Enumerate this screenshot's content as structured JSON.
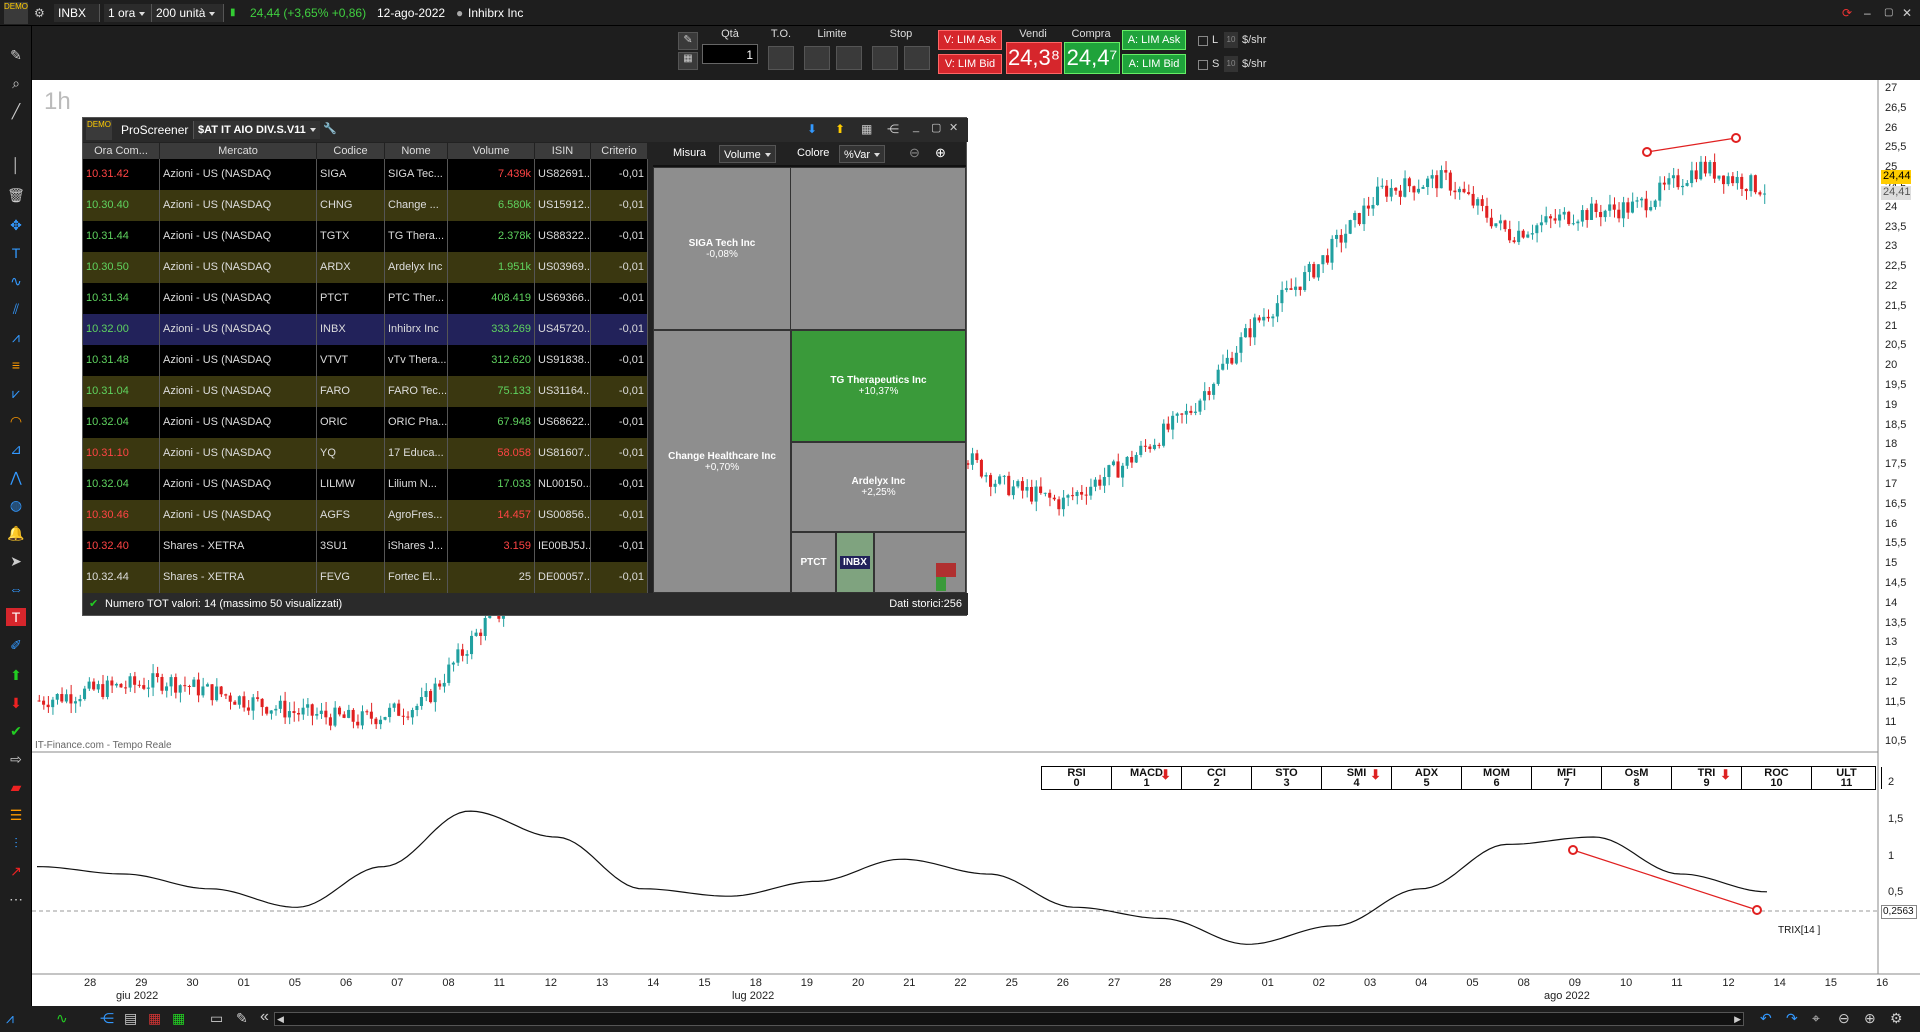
{
  "topbar": {
    "symbol": "INBX",
    "timeframe": "1 ora",
    "quantity": "200 unità",
    "last_price_change": "24,44 (+3,65% +0,86)",
    "date": "12-ago-2022",
    "company": "Inhibrx Inc"
  },
  "orderbar": {
    "qty_label": "Qtà",
    "qty_value": "1",
    "to_label": "T.O.",
    "limit_label": "Limite",
    "stop_label": "Stop",
    "sell_lim_ask": "V: LIM Ask",
    "sell_lim_bid": "V: LIM Bid",
    "sell_label": "Vendi",
    "sell_price": "24,3⁸",
    "buy_label": "Compra",
    "buy_price": "24,4⁷",
    "buy_lim_ask": "A: LIM Ask",
    "buy_lim_bid": "A: LIM Bid",
    "l_label": "L",
    "s_label": "S",
    "l_value": "10",
    "s_value": "10",
    "unit": "$/shr"
  },
  "chart": {
    "timeframe_label": "1h",
    "source": "IT-Finance.com - Tempo Reale",
    "price_last": "24,44",
    "price_prev": "24,41",
    "y_ticks": [
      "27",
      "26,5",
      "26",
      "25,5",
      "25",
      "24,5",
      "24",
      "23,5",
      "23",
      "22,5",
      "22",
      "21,5",
      "21",
      "20,5",
      "20",
      "19,5",
      "19",
      "18,5",
      "18",
      "17,5",
      "17",
      "16,5",
      "16",
      "15,5",
      "15",
      "14,5",
      "14",
      "13,5",
      "13",
      "12,5",
      "12",
      "11,5",
      "11",
      "10,5"
    ],
    "x_ticks": [
      "28",
      "29",
      "30",
      "01",
      "05",
      "06",
      "07",
      "08",
      "11",
      "12",
      "13",
      "14",
      "15",
      "18",
      "19",
      "20",
      "21",
      "22",
      "25",
      "26",
      "27",
      "28",
      "29",
      "01",
      "02",
      "03",
      "04",
      "05",
      "08",
      "09",
      "10",
      "11",
      "12",
      "14",
      "15",
      "16"
    ],
    "months": [
      "giu 2022",
      "lug 2022",
      "ago 2022"
    ],
    "trix_label": "TRIX[14 ]",
    "trix_value": "0,2563",
    "ind_y_ticks": [
      "2",
      "1,5",
      "1",
      "0,5"
    ]
  },
  "chart_data": {
    "type": "line",
    "title": "",
    "xlabel": "",
    "ylabel": "",
    "note_candles": "INBX hourly candles",
    "series": [
      {
        "name": "INBX",
        "values": [
          11.5,
          11.8,
          12.0,
          11.6,
          11.2,
          11.0,
          11.4,
          13.5,
          14.5,
          18.0,
          19.5,
          19.0,
          18.6,
          19.0,
          18.4,
          17.0,
          16.5,
          17.5,
          18.8,
          21.0,
          22.5,
          24.4,
          24.7,
          23.3,
          23.8,
          24.0,
          25.0,
          24.44
        ]
      },
      {
        "name": "TRIX[14 ]",
        "values": [
          0.6,
          0.5,
          0.3,
          0.05,
          0.6,
          1.35,
          1.0,
          0.3,
          0.2,
          0.4,
          0.7,
          0.5,
          0.05,
          -0.1,
          -0.45,
          -0.2,
          0.3,
          0.9,
          1.0,
          0.5,
          0.26
        ]
      }
    ],
    "ylim": [
      10.5,
      27
    ]
  },
  "indicator_tabs": [
    {
      "name": "RSI",
      "num": "0",
      "arrow": false
    },
    {
      "name": "MACD",
      "num": "1",
      "arrow": true
    },
    {
      "name": "CCI",
      "num": "2",
      "arrow": false
    },
    {
      "name": "STO",
      "num": "3",
      "arrow": false
    },
    {
      "name": "SMI",
      "num": "4",
      "arrow": true
    },
    {
      "name": "ADX",
      "num": "5",
      "arrow": false
    },
    {
      "name": "MOM",
      "num": "6",
      "arrow": false
    },
    {
      "name": "MFI",
      "num": "7",
      "arrow": false
    },
    {
      "name": "OsM",
      "num": "8",
      "arrow": false
    },
    {
      "name": "TRI",
      "num": "9",
      "arrow": true
    },
    {
      "name": "ROC",
      "num": "10",
      "arrow": false
    },
    {
      "name": "ULT",
      "num": "11",
      "arrow": false
    }
  ],
  "screener": {
    "title": "ProScreener",
    "preset": "$AT IT AIO DIV.S.V11",
    "columns": [
      "Ora Com...",
      "Mercato",
      "Codice",
      "Nome",
      "Volume",
      "ISIN",
      "Criterio"
    ],
    "rows": [
      {
        "time": "10.31.42",
        "market": "Azioni - US (NASDAQ",
        "code": "SIGA",
        "name": "SIGA Tec...",
        "volume": "7.439k",
        "isin": "US82691...",
        "crit": "-0,01",
        "tcolor": "#ff4444",
        "vcolor": "#ff4444",
        "bg": "#000000"
      },
      {
        "time": "10.30.40",
        "market": "Azioni - US (NASDAQ",
        "code": "CHNG",
        "name": "Change ...",
        "volume": "6.580k",
        "isin": "US15912...",
        "crit": "-0,01",
        "tcolor": "#5fd35f",
        "vcolor": "#5fd35f",
        "bg": "#3a3710"
      },
      {
        "time": "10.31.44",
        "market": "Azioni - US (NASDAQ",
        "code": "TGTX",
        "name": "TG Thera...",
        "volume": "2.378k",
        "isin": "US88322...",
        "crit": "-0,01",
        "tcolor": "#5fd35f",
        "vcolor": "#5fd35f",
        "bg": "#000000"
      },
      {
        "time": "10.30.50",
        "market": "Azioni - US (NASDAQ",
        "code": "ARDX",
        "name": "Ardelyx Inc",
        "volume": "1.951k",
        "isin": "US03969...",
        "crit": "-0,01",
        "tcolor": "#5fd35f",
        "vcolor": "#5fd35f",
        "bg": "#3a3710"
      },
      {
        "time": "10.31.34",
        "market": "Azioni - US (NASDAQ",
        "code": "PTCT",
        "name": "PTC Ther...",
        "volume": "408.419",
        "isin": "US69366...",
        "crit": "-0,01",
        "tcolor": "#5fd35f",
        "vcolor": "#5fd35f",
        "bg": "#000000"
      },
      {
        "time": "10.32.00",
        "market": "Azioni - US (NASDAQ",
        "code": "INBX",
        "name": "Inhibrx Inc",
        "volume": "333.269",
        "isin": "US45720...",
        "crit": "-0,01",
        "tcolor": "#5fd35f",
        "vcolor": "#5fd35f",
        "bg": "#22225a"
      },
      {
        "time": "10.31.48",
        "market": "Azioni - US (NASDAQ",
        "code": "VTVT",
        "name": "vTv Thera...",
        "volume": "312.620",
        "isin": "US91838...",
        "crit": "-0,01",
        "tcolor": "#5fd35f",
        "vcolor": "#5fd35f",
        "bg": "#000000"
      },
      {
        "time": "10.31.04",
        "market": "Azioni - US (NASDAQ",
        "code": "FARO",
        "name": "FARO Tec...",
        "volume": "75.133",
        "isin": "US31164...",
        "crit": "-0,01",
        "tcolor": "#5fd35f",
        "vcolor": "#5fd35f",
        "bg": "#3a3710"
      },
      {
        "time": "10.32.04",
        "market": "Azioni - US (NASDAQ",
        "code": "ORIC",
        "name": "ORIC Pha...",
        "volume": "67.948",
        "isin": "US68622...",
        "crit": "-0,01",
        "tcolor": "#5fd35f",
        "vcolor": "#5fd35f",
        "bg": "#000000"
      },
      {
        "time": "10.31.10",
        "market": "Azioni - US (NASDAQ",
        "code": "YQ",
        "name": "17 Educa...",
        "volume": "58.058",
        "isin": "US81607...",
        "crit": "-0,01",
        "tcolor": "#ff4444",
        "vcolor": "#ff4444",
        "bg": "#3a3710"
      },
      {
        "time": "10.32.04",
        "market": "Azioni - US (NASDAQ",
        "code": "LILMW",
        "name": "Lilium N...",
        "volume": "17.033",
        "isin": "NL00150...",
        "crit": "-0,01",
        "tcolor": "#5fd35f",
        "vcolor": "#5fd35f",
        "bg": "#000000"
      },
      {
        "time": "10.30.46",
        "market": "Azioni - US (NASDAQ",
        "code": "AGFS",
        "name": "AgroFres...",
        "volume": "14.457",
        "isin": "US00856...",
        "crit": "-0,01",
        "tcolor": "#ff4444",
        "vcolor": "#ff4444",
        "bg": "#3a3710"
      },
      {
        "time": "10.32.40",
        "market": "Shares - XETRA",
        "code": "3SU1",
        "name": "iShares J...",
        "volume": "3.159",
        "isin": "IE00BJ5J...",
        "crit": "-0,01",
        "tcolor": "#ff4444",
        "vcolor": "#ff4444",
        "bg": "#000000"
      },
      {
        "time": "10.32.44",
        "market": "Shares - XETRA",
        "code": "FEVG",
        "name": "Fortec El...",
        "volume": "25",
        "isin": "DE00057...",
        "crit": "-0,01",
        "tcolor": "#dddddd",
        "vcolor": "#dddddd",
        "bg": "#3a3710"
      }
    ],
    "measure_label": "Misura",
    "measure_value": "Volume",
    "color_label": "Colore",
    "color_value": "%Var",
    "treemap": [
      {
        "name": "SIGA Tech Inc",
        "pct": "-0,08%"
      },
      {
        "name": "Change Healthcare Inc",
        "pct": "+0,70%"
      },
      {
        "name": "TG Therapeutics Inc",
        "pct": "+10,37%"
      },
      {
        "name": "Ardelyx Inc",
        "pct": "+2,25%"
      },
      {
        "name": "PTCT",
        "pct": ""
      },
      {
        "name": "INBX",
        "pct": ""
      }
    ],
    "status_left": "Numero TOT valori: 14 (massimo 50 visualizzati)",
    "status_right": "Dati storici:256"
  }
}
